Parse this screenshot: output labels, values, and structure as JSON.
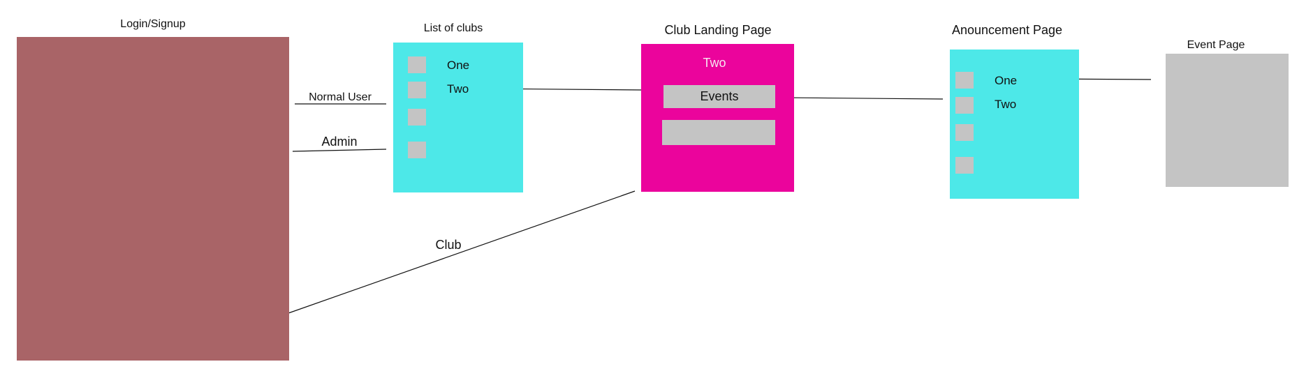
{
  "colors": {
    "login_box": "#a96467",
    "list_box": "#4de8e8",
    "club_box": "#eb049c",
    "gray": "#c4c4c4",
    "line": "#111111"
  },
  "login": {
    "title": "Login/Signup"
  },
  "clubs_list": {
    "title": "List of clubs",
    "items": [
      "One",
      "Two"
    ]
  },
  "club_landing": {
    "title": "Club Landing Page",
    "club_name": "Two",
    "events_label": "Events"
  },
  "announcement": {
    "title": "Anouncement Page",
    "items": [
      "One",
      "Two"
    ]
  },
  "event_page": {
    "title": "Event Page"
  },
  "connections": {
    "normal_user": "Normal User",
    "admin": "Admin",
    "club": "Club"
  }
}
